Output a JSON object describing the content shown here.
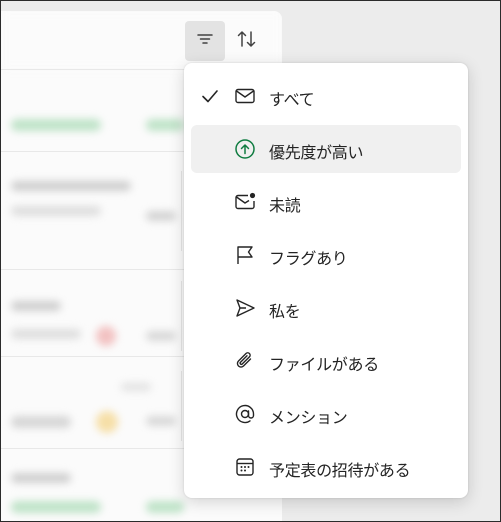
{
  "toolbar": {
    "filter_button": "filter-icon",
    "sort_button": "sort-icon"
  },
  "filter_menu": {
    "selected_index": 0,
    "hover_index": 1,
    "items": [
      {
        "label": "すべて",
        "icon": "mail-icon"
      },
      {
        "label": "優先度が高い",
        "icon": "arrow-up-circle-icon",
        "icon_color": "#107c41"
      },
      {
        "label": "未読",
        "icon": "mail-unread-icon"
      },
      {
        "label": "フラグあり",
        "icon": "flag-icon"
      },
      {
        "label": "私を",
        "icon": "send-icon"
      },
      {
        "label": "ファイルがある",
        "icon": "attach-icon"
      },
      {
        "label": "メンション",
        "icon": "mention-icon"
      },
      {
        "label": "予定表の招待がある",
        "icon": "calendar-icon"
      }
    ]
  },
  "colors": {
    "accent_green": "#107c41",
    "text": "#242424",
    "menu_bg": "#ffffff",
    "hover_bg": "#f0f0f0"
  }
}
